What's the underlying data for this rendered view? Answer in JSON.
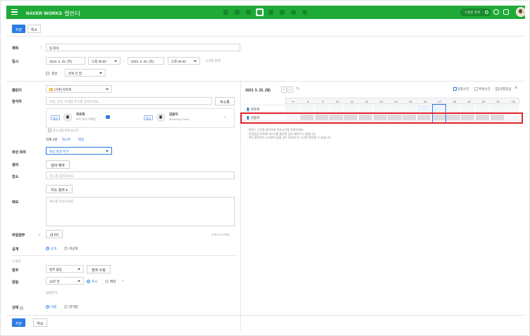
{
  "header": {
    "brand": "NAVER WORKS",
    "app": "캘린더",
    "search_label": "구성원 검색",
    "apps": [
      "mail-app-icon",
      "message-app-icon",
      "envelope-app-icon",
      "calendar-app-icon",
      "contacts-app-icon",
      "drive-app-icon",
      "home-app-icon",
      "circle-app-icon"
    ]
  },
  "toolbar": {
    "save": "저장",
    "cancel": "취소"
  },
  "form": {
    "title_label": "제목",
    "title_value": "팀 회의",
    "date_label": "일시",
    "start_date": "2023. 5. 25. (목)",
    "start_time": "오후 05:00",
    "end_date": "2023. 5. 25. (목)",
    "end_time": "오후 06:00",
    "timezone_link": "시간대 변경",
    "allday": "종일",
    "repeat": "반복 안 함",
    "calendar_label": "캘린더",
    "calendar_value": "[기본] 차조축",
    "attendee_label": "참석자",
    "attendee_placeholder": "이름, 조직, 이메일 주소를 입력하세요.",
    "address_book": "주소록",
    "attendees": [
      {
        "tag": "필수",
        "name": "차조축",
        "dept": "파트 회의 기획팀"
      },
      {
        "tag": "필수",
        "name": "김용지",
        "dept": "Marketing Team"
      }
    ],
    "hide_list": "참석 일정 목록 숨기기",
    "all_count": "전체 2명",
    "all_links": [
      "메시지",
      "메일"
    ],
    "video_label": "화상 회의",
    "video_value": "화상 회의 추가",
    "equipment_label": "설비",
    "equipment_btn": "설비 예약",
    "place_label": "장소",
    "place_placeholder": "장소를 입력하세요.",
    "map_btn": "지도 첨부",
    "memo_label": "메모",
    "memo_placeholder": "메모를 작성하세요.",
    "attach_label": "파일첨부",
    "attach_btn": "내 PC",
    "attach_size": "0KB/100.00MB",
    "public_label": "공개",
    "public_on": "공개",
    "public_off": "비공개",
    "my_settings": "내 설정",
    "category_label": "범주",
    "category_value": "범주 없음",
    "category_edit": "범주 수정",
    "alarm_label": "알림",
    "alarm_value": "10분 전",
    "alarm_push": "푸시",
    "alarm_mail": "메일",
    "alarm_add": "알림추가",
    "status_label": "상태",
    "status_busy": "바쁨",
    "status_free": "한가함"
  },
  "schedule": {
    "date": "2023. 5. 25. (목)",
    "legend": [
      "일정시간",
      "추천시간",
      "일정있음"
    ],
    "hours": [
      "0~",
      "8",
      "9",
      "10",
      "11",
      "12",
      "13",
      "14",
      "15",
      "16",
      "17",
      "18",
      "19",
      "20",
      "21",
      "~24"
    ],
    "rows": [
      "차조축",
      "김용지"
    ],
    "notes": [
      "- 원하는 시간을 클릭하여 약속시간을 변경하세요.",
      "- 일정있음 영역에 마우스를 올리면 일정 제목이 노출됩니다.",
      "- 약속 참석자가 100명이 넘을 경우 일부의 된 시간만 확인할 수 있습니다."
    ]
  },
  "colors": {
    "brand": "#1faa38",
    "primary": "#2c7be5",
    "highlight": "#e0202a",
    "busy": "#dcdcdc"
  }
}
